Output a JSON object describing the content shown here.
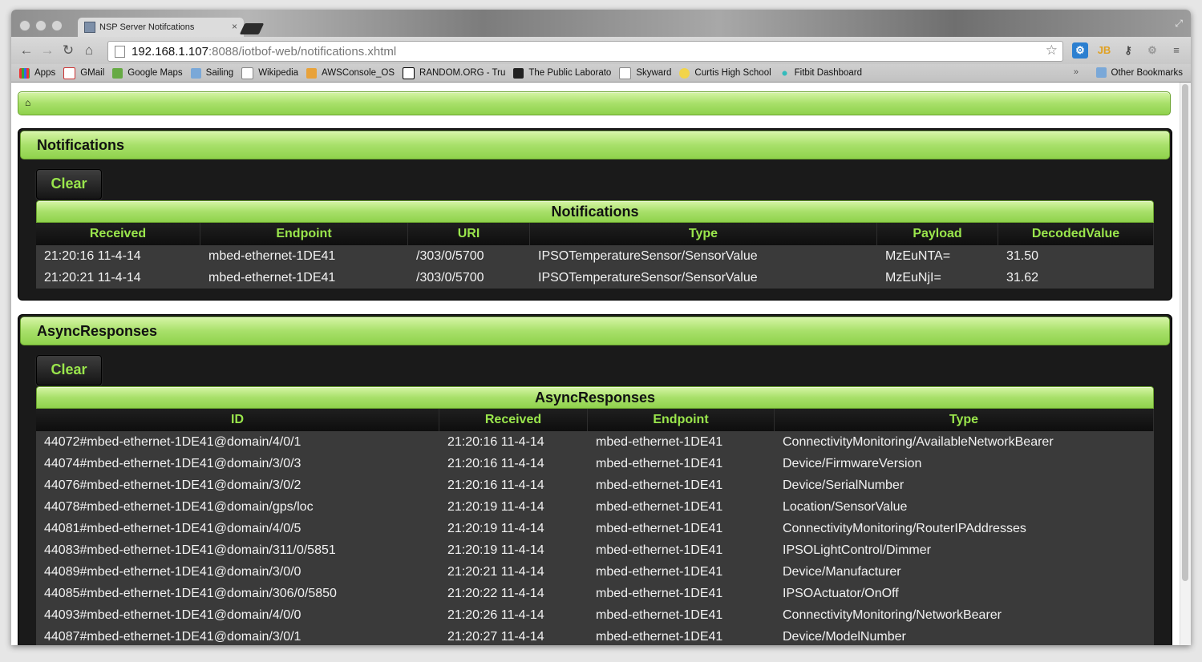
{
  "browser": {
    "tab_title": "NSP Server Notifcations",
    "url_host": "192.168.1.107",
    "url_rest": ":8088/iotbof-web/notifications.xhtml",
    "bookmarks": [
      "Apps",
      "GMail",
      "Google Maps",
      "Sailing",
      "Wikipedia",
      "AWSConsole_OS",
      "RANDOM.ORG - Tru",
      "The Public Laborato",
      "Skyward",
      "Curtis High School",
      "Fitbit Dashboard"
    ],
    "other_bookmarks": "Other Bookmarks",
    "ext_jb": "JB"
  },
  "notifications": {
    "header": "Notifications",
    "clear_label": "Clear",
    "table_caption": "Notifications",
    "columns": [
      "Received",
      "Endpoint",
      "URI",
      "Type",
      "Payload",
      "DecodedValue"
    ],
    "rows": [
      [
        "21:20:16 11-4-14",
        "mbed-ethernet-1DE41",
        "/303/0/5700",
        "IPSOTemperatureSensor/SensorValue",
        "MzEuNTA=",
        "31.50"
      ],
      [
        "21:20:21 11-4-14",
        "mbed-ethernet-1DE41",
        "/303/0/5700",
        "IPSOTemperatureSensor/SensorValue",
        "MzEuNjI=",
        "31.62"
      ]
    ]
  },
  "async": {
    "header": "AsyncResponses",
    "clear_label": "Clear",
    "table_caption": "AsyncResponses",
    "columns": [
      "ID",
      "Received",
      "Endpoint",
      "Type"
    ],
    "rows": [
      [
        "44072#mbed-ethernet-1DE41@domain/4/0/1",
        "21:20:16 11-4-14",
        "mbed-ethernet-1DE41",
        "ConnectivityMonitoring/AvailableNetworkBearer"
      ],
      [
        "44074#mbed-ethernet-1DE41@domain/3/0/3",
        "21:20:16 11-4-14",
        "mbed-ethernet-1DE41",
        "Device/FirmwareVersion"
      ],
      [
        "44076#mbed-ethernet-1DE41@domain/3/0/2",
        "21:20:16 11-4-14",
        "mbed-ethernet-1DE41",
        "Device/SerialNumber"
      ],
      [
        "44078#mbed-ethernet-1DE41@domain/gps/loc",
        "21:20:19 11-4-14",
        "mbed-ethernet-1DE41",
        "Location/SensorValue"
      ],
      [
        "44081#mbed-ethernet-1DE41@domain/4/0/5",
        "21:20:19 11-4-14",
        "mbed-ethernet-1DE41",
        "ConnectivityMonitoring/RouterIPAddresses"
      ],
      [
        "44083#mbed-ethernet-1DE41@domain/311/0/5851",
        "21:20:19 11-4-14",
        "mbed-ethernet-1DE41",
        "IPSOLightControl/Dimmer"
      ],
      [
        "44089#mbed-ethernet-1DE41@domain/3/0/0",
        "21:20:21 11-4-14",
        "mbed-ethernet-1DE41",
        "Device/Manufacturer"
      ],
      [
        "44085#mbed-ethernet-1DE41@domain/306/0/5850",
        "21:20:22 11-4-14",
        "mbed-ethernet-1DE41",
        "IPSOActuator/OnOff"
      ],
      [
        "44093#mbed-ethernet-1DE41@domain/4/0/0",
        "21:20:26 11-4-14",
        "mbed-ethernet-1DE41",
        "ConnectivityMonitoring/NetworkBearer"
      ],
      [
        "44087#mbed-ethernet-1DE41@domain/3/0/1",
        "21:20:27 11-4-14",
        "mbed-ethernet-1DE41",
        "Device/ModelNumber"
      ]
    ]
  }
}
